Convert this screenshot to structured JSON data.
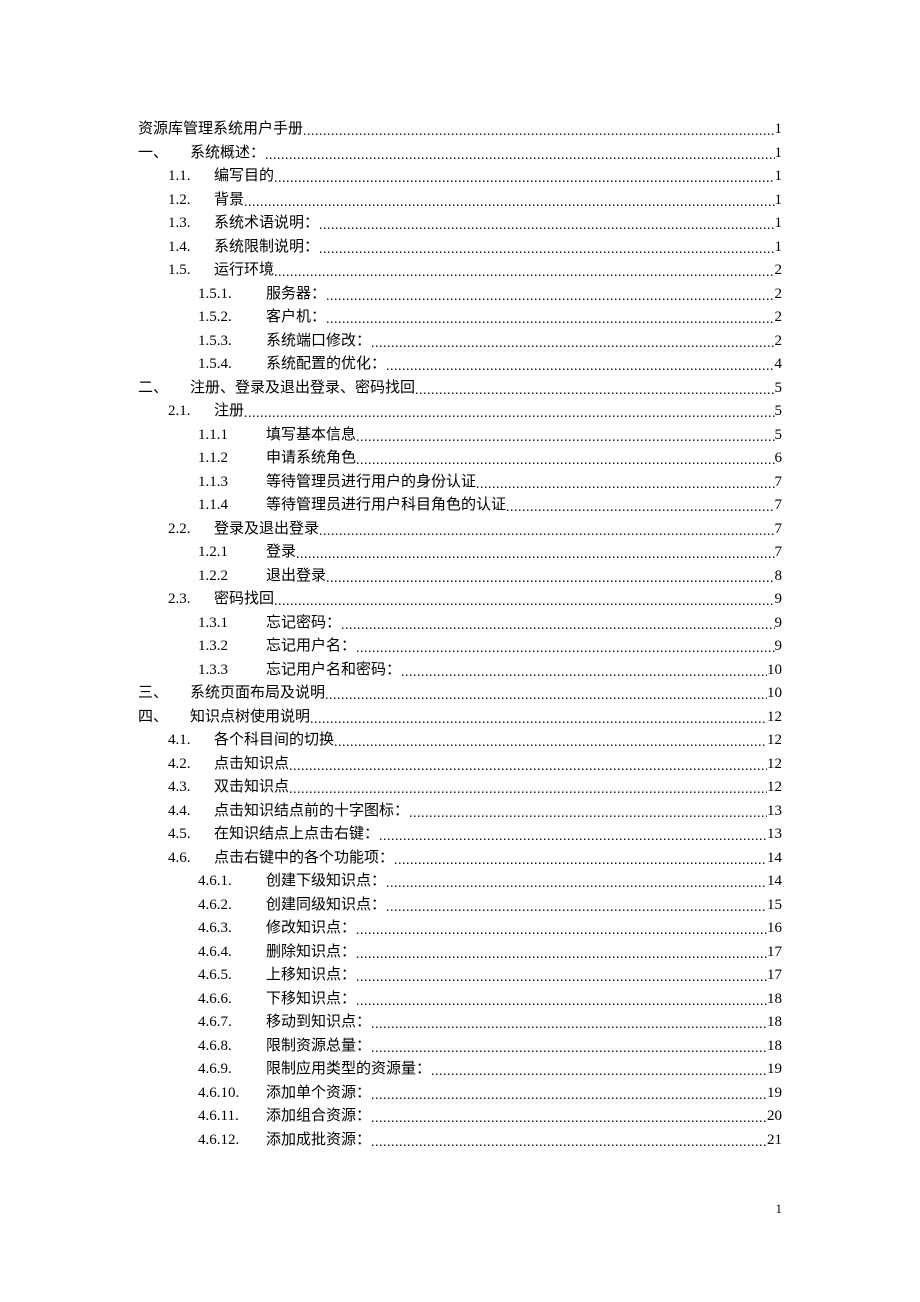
{
  "page_footer": "1",
  "toc": [
    {
      "level": 0,
      "num": "",
      "title": "资源库管理系统用户手册",
      "page": "1"
    },
    {
      "level": 0,
      "num": "一、",
      "title": "系统概述：",
      "page": "1"
    },
    {
      "level": 1,
      "num": "1.1.",
      "title": "编写目的",
      "page": "1"
    },
    {
      "level": 1,
      "num": "1.2.",
      "title": "背景",
      "page": "1"
    },
    {
      "level": 1,
      "num": "1.3.",
      "title": "系统术语说明：",
      "page": "1"
    },
    {
      "level": 1,
      "num": "1.4.",
      "title": "系统限制说明：",
      "page": "1"
    },
    {
      "level": 1,
      "num": "1.5.",
      "title": "运行环境",
      "page": "2"
    },
    {
      "level": 2,
      "num": "1.5.1.",
      "title": "服务器：",
      "page": "2"
    },
    {
      "level": 2,
      "num": "1.5.2.",
      "title": "客户机：",
      "page": "2"
    },
    {
      "level": 2,
      "num": "1.5.3.",
      "title": "系统端口修改：",
      "page": "2"
    },
    {
      "level": 2,
      "num": "1.5.4.",
      "title": "系统配置的优化：",
      "page": "4"
    },
    {
      "level": 0,
      "num": "二、",
      "title": "注册、登录及退出登录、密码找回",
      "page": "5"
    },
    {
      "level": 1,
      "num": "2.1.",
      "title": "注册",
      "page": "5"
    },
    {
      "level": 2,
      "num": "1.1.1",
      "title": "填写基本信息",
      "page": "5"
    },
    {
      "level": 2,
      "num": "1.1.2",
      "title": "申请系统角色",
      "page": "6"
    },
    {
      "level": 2,
      "num": "1.1.3",
      "title": "等待管理员进行用户的身份认证",
      "page": "7"
    },
    {
      "level": 2,
      "num": "1.1.4",
      "title": "等待管理员进行用户科目角色的认证",
      "page": "7"
    },
    {
      "level": 1,
      "num": "2.2.",
      "title": "登录及退出登录",
      "page": "7"
    },
    {
      "level": 2,
      "num": "1.2.1",
      "title": "登录",
      "page": "7"
    },
    {
      "level": 2,
      "num": "1.2.2",
      "title": "退出登录",
      "page": "8"
    },
    {
      "level": 1,
      "num": "2.3.",
      "title": "密码找回",
      "page": "9"
    },
    {
      "level": 2,
      "num": "1.3.1",
      "title": "忘记密码：",
      "page": "9"
    },
    {
      "level": 2,
      "num": "1.3.2",
      "title": "忘记用户名：",
      "page": "9"
    },
    {
      "level": 2,
      "num": "1.3.3",
      "title": "忘记用户名和密码：",
      "page": "10"
    },
    {
      "level": 0,
      "num": "三、",
      "title": "系统页面布局及说明",
      "page": "10"
    },
    {
      "level": 0,
      "num": "四、",
      "title": "知识点树使用说明",
      "page": "12"
    },
    {
      "level": 1,
      "num": "4.1.",
      "title": "各个科目间的切换",
      "page": "12"
    },
    {
      "level": 1,
      "num": "4.2.",
      "title": "点击知识点",
      "page": "12"
    },
    {
      "level": 1,
      "num": "4.3.",
      "title": "双击知识点",
      "page": "12"
    },
    {
      "level": 1,
      "num": "4.4.",
      "title": "点击知识结点前的十字图标：",
      "page": "13"
    },
    {
      "level": 1,
      "num": "4.5.",
      "title": "在知识结点上点击右键：",
      "page": "13"
    },
    {
      "level": 1,
      "num": "4.6.",
      "title": "点击右键中的各个功能项：",
      "page": "14"
    },
    {
      "level": 2,
      "num": "4.6.1.",
      "title": "创建下级知识点：",
      "page": "14"
    },
    {
      "level": 2,
      "num": "4.6.2.",
      "title": "创建同级知识点：",
      "page": "15"
    },
    {
      "level": 2,
      "num": "4.6.3.",
      "title": "修改知识点：",
      "page": "16"
    },
    {
      "level": 2,
      "num": "4.6.4.",
      "title": "删除知识点：",
      "page": "17"
    },
    {
      "level": 2,
      "num": "4.6.5.",
      "title": "上移知识点：",
      "page": "17"
    },
    {
      "level": 2,
      "num": "4.6.6.",
      "title": "下移知识点：",
      "page": "18"
    },
    {
      "level": 2,
      "num": "4.6.7.",
      "title": "移动到知识点：",
      "page": "18"
    },
    {
      "level": 2,
      "num": "4.6.8.",
      "title": "限制资源总量：",
      "page": "18"
    },
    {
      "level": 2,
      "num": "4.6.9.",
      "title": "限制应用类型的资源量：",
      "page": "19"
    },
    {
      "level": 2,
      "num": "4.6.10.",
      "title": "添加单个资源：",
      "page": "19"
    },
    {
      "level": 2,
      "num": "4.6.11.",
      "title": "添加组合资源：",
      "page": "20"
    },
    {
      "level": 2,
      "num": "4.6.12.",
      "title": "添加成批资源：",
      "page": "21"
    }
  ]
}
